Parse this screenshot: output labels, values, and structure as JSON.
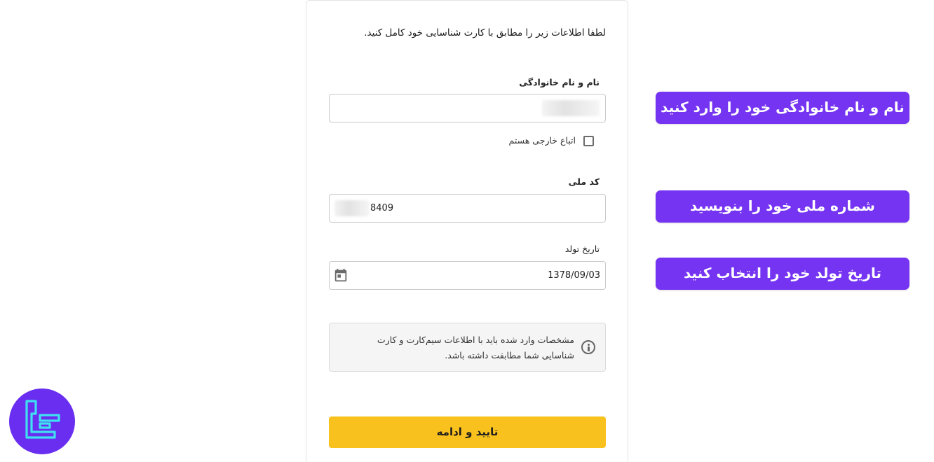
{
  "form": {
    "intro_text": "لطفا اطلاعات زیر را مطابق با کارت شناسایی خود کامل کنید.",
    "full_name": {
      "label": "نام و نام خانوادگی",
      "value": ""
    },
    "foreign_national": {
      "label": "اتباع خارجی هستم",
      "checked": false
    },
    "national_code": {
      "label": "کد ملی",
      "value": "8409"
    },
    "birth_date": {
      "label": "تاریخ تولد",
      "value": "1378/09/03",
      "icon": "calendar-icon"
    },
    "info": {
      "icon": "info-icon",
      "text": "مشخصات وارد شده باید با اطلاعات سیم‌کارت و کارت شناسایی شما مطابقت داشته باشد."
    },
    "submit_label": "تایید و ادامه"
  },
  "callouts": [
    "نام و نام خانوادگی خود را وارد کنید",
    "شماره ملی خود را بنویسید",
    "تاریخ تولد خود را انتخاب کنید"
  ],
  "colors": {
    "accent_purple": "#7533f2",
    "button_yellow": "#f9c11d",
    "logo_cyan": "#3fe0f0"
  },
  "logo": {
    "icon": "brand-logo"
  }
}
